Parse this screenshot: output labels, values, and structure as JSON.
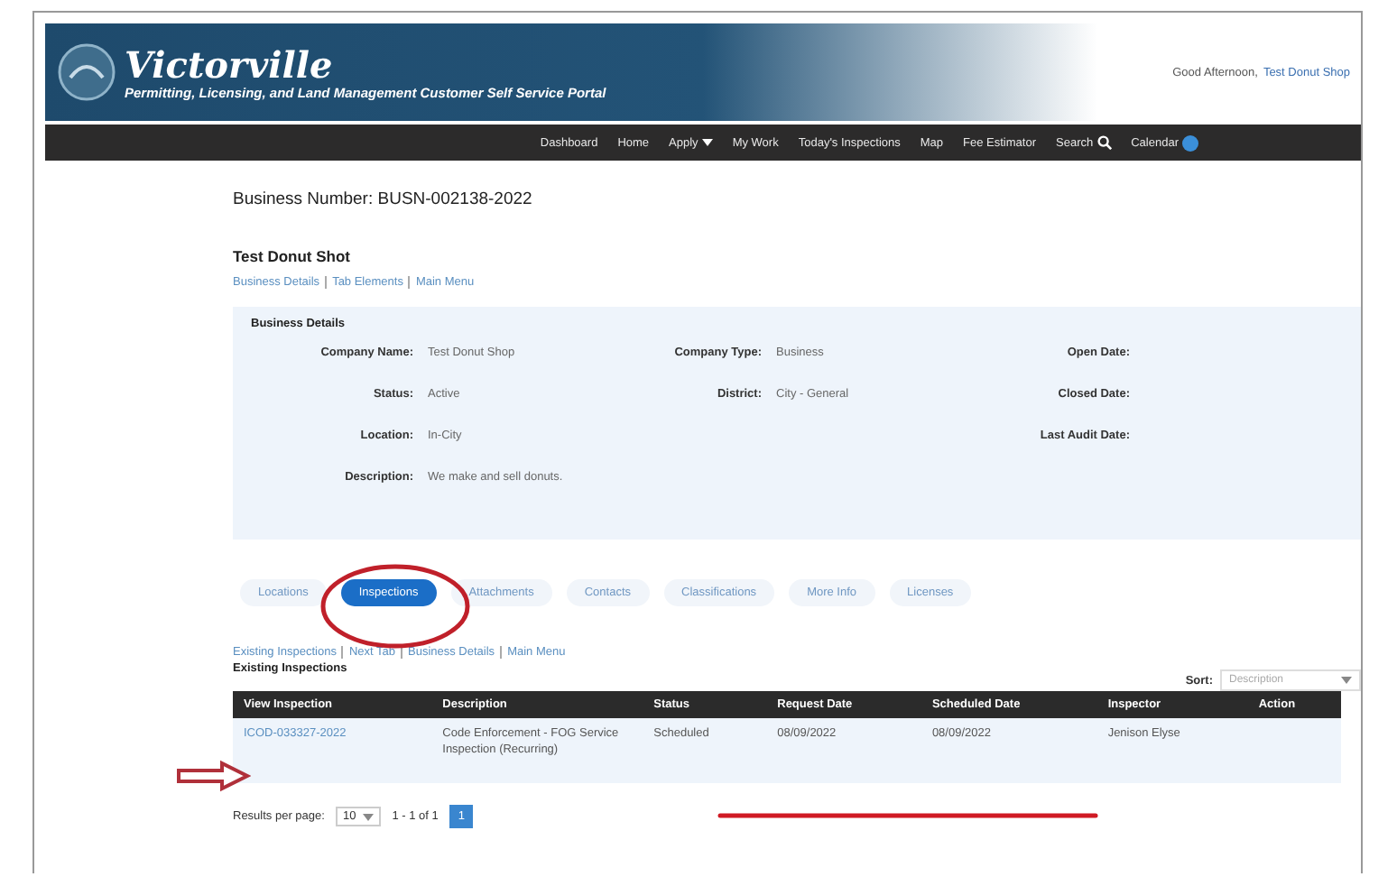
{
  "header": {
    "logo": "Victorville",
    "portal_title": "Permitting, Licensing, and Land Management Customer Self Service Portal",
    "greeting": "Good Afternoon,",
    "user_link": "Test Donut Shop"
  },
  "nav": [
    {
      "label": "Dashboard",
      "kind": "link"
    },
    {
      "label": "Home",
      "kind": "link"
    },
    {
      "label": "Apply",
      "kind": "dropdown"
    },
    {
      "label": "My Work",
      "kind": "link"
    },
    {
      "label": "Today's Inspections",
      "kind": "link"
    },
    {
      "label": "Map",
      "kind": "link"
    },
    {
      "label": "Fee Estimator",
      "kind": "link"
    },
    {
      "label": "Search",
      "kind": "search"
    },
    {
      "label": "Calendar",
      "kind": "calendar"
    }
  ],
  "business_number": "Business Number: BUSN-002138-2022",
  "business_name": "Test Donut Shot",
  "top_links": [
    "Business Details",
    "Tab Elements",
    "Main Menu"
  ],
  "details": {
    "title": "Business Details",
    "columns": [
      [
        {
          "label": "Company Name:",
          "value": "Test Donut Shop"
        },
        {
          "label": "Status:",
          "value": "Active"
        },
        {
          "label": "Location:",
          "value": "In-City"
        },
        {
          "label": "Description:",
          "value": "We make and sell donuts."
        }
      ],
      [
        {
          "label": "Company Type:",
          "value": "Business"
        },
        {
          "label": "District:",
          "value": "City - General"
        }
      ],
      [
        {
          "label": "Open Date:"
        },
        {
          "label": "Closed Date:"
        },
        {
          "label": "Last Audit Date:"
        }
      ]
    ]
  },
  "tabs": [
    {
      "label": "Locations",
      "selected": false
    },
    {
      "label": "Inspections",
      "selected": true
    },
    {
      "label": "Attachments",
      "selected": false
    },
    {
      "label": "Contacts",
      "selected": false
    },
    {
      "label": "Classifications",
      "selected": false
    },
    {
      "label": "More Info",
      "selected": false
    },
    {
      "label": "Licenses",
      "selected": false
    }
  ],
  "section_links": [
    "Existing Inspections",
    "Next Tab",
    "Business Details",
    "Main Menu"
  ],
  "section_title": "Existing Inspections",
  "sort": {
    "label": "Sort:",
    "value": "Description"
  },
  "table": {
    "columns": [
      "View Inspection",
      "Description",
      "Status",
      "Request Date",
      "Scheduled Date",
      "Inspector",
      "Action"
    ],
    "rows": [
      {
        "cells": [
          "ICOD-033327-2022",
          "Code Enforcement - FOG Service Inspection (Recurring)",
          "Scheduled",
          "08/09/2022",
          "08/09/2022",
          "Jenison Elyse"
        ]
      }
    ]
  },
  "pagination": {
    "label": "Results per page:",
    "page_size": "10",
    "range": "1 - 1 of 1",
    "pages": [
      {
        "label": "1",
        "selected": true
      }
    ]
  }
}
